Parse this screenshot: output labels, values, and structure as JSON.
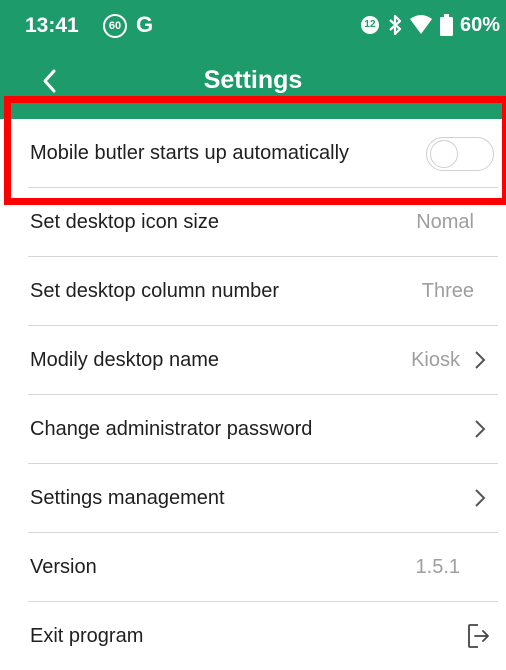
{
  "status_bar": {
    "time": "13:41",
    "badge": "60",
    "carrier": "G",
    "sim_badge": "②",
    "battery": "60%"
  },
  "header": {
    "title": "Settings"
  },
  "settings": [
    {
      "label": "Mobile butler starts up automatically",
      "toggle": "off"
    },
    {
      "label": "Set desktop icon size",
      "value": "Nomal"
    },
    {
      "label": "Set desktop column number",
      "value": "Three"
    },
    {
      "label": "Modily desktop name",
      "value": "Kiosk"
    },
    {
      "label": "Change administrator password"
    },
    {
      "label": "Settings management"
    },
    {
      "label": "Version",
      "value": "1.5.1"
    },
    {
      "label": "Exit program"
    }
  ],
  "colors": {
    "header": "#1e9b6b",
    "highlight": "#ff0000"
  }
}
